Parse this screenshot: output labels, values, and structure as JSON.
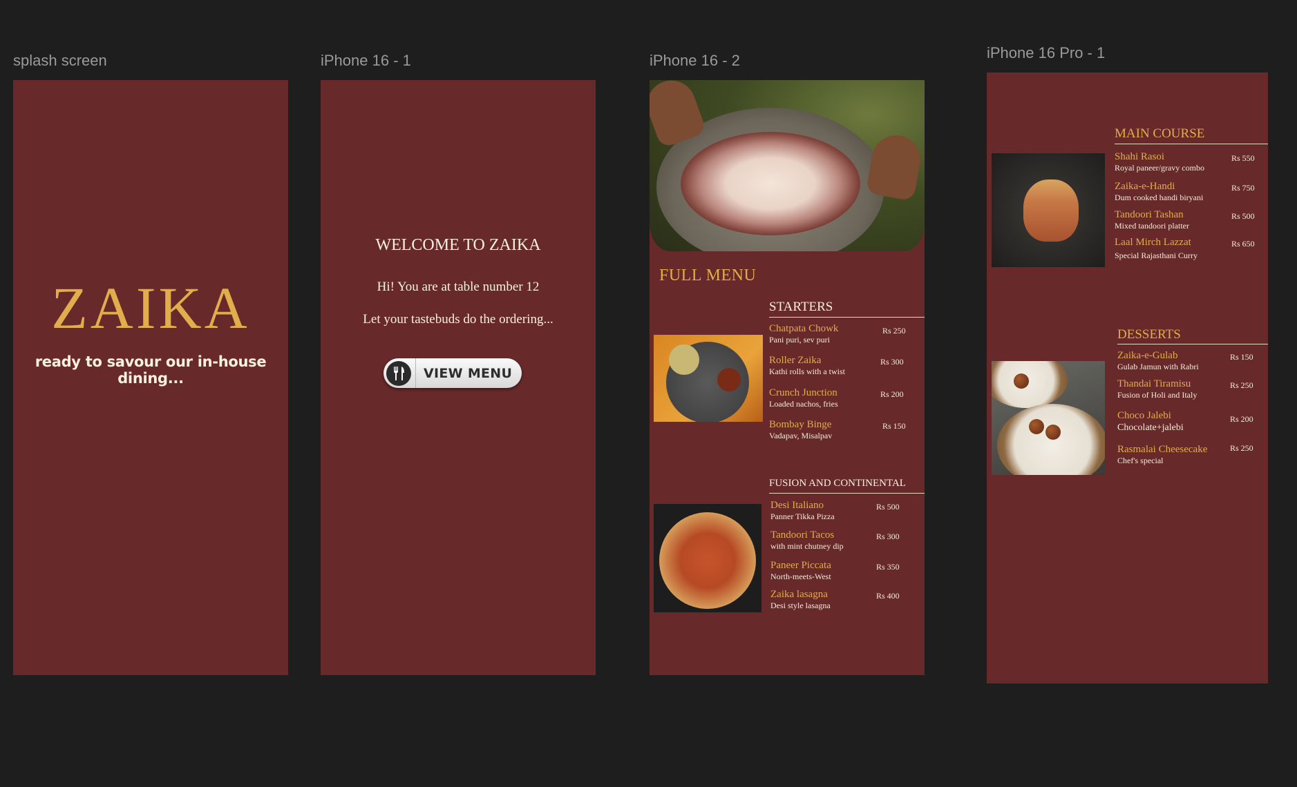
{
  "frames": {
    "splash": {
      "label": "splash screen",
      "logo": "ZAIKA",
      "tagline": "ready to savour our in-house dining..."
    },
    "welcome": {
      "label": "iPhone 16 - 1",
      "title": "WELCOME TO ZAIKA",
      "table_text": "Hi! You are at table number 12",
      "subtitle": "Let your tastebuds do the ordering...",
      "button_label": "VIEW MENU",
      "button_icon": "fork-knife-icon"
    },
    "full_menu": {
      "label": "iPhone 16 - 2",
      "heading": "FULL MENU",
      "starters": {
        "title": "STARTERS",
        "items": [
          {
            "name": "Chatpata Chowk",
            "desc": "Pani puri, sev puri",
            "price": "Rs 250"
          },
          {
            "name": "Roller Zaika",
            "desc": "Kathi rolls with a twist",
            "price": "Rs 300"
          },
          {
            "name": "Crunch Junction",
            "desc": "Loaded nachos, fries",
            "price": "Rs 200"
          },
          {
            "name": "Bombay Binge",
            "desc": "Vadapav, Misalpav",
            "price": "Rs 150"
          }
        ]
      },
      "fusion": {
        "title": "FUSION AND CONTINENTAL",
        "items": [
          {
            "name": "Desi Italiano",
            "desc": "Panner Tikka Pizza",
            "price": "Rs 500"
          },
          {
            "name": "Tandoori Tacos",
            "desc": "with mint chutney dip",
            "price": "Rs 300"
          },
          {
            "name": "Paneer Piccata",
            "desc": "North-meets-West",
            "price": "Rs 350"
          },
          {
            "name": "Zaika lasagna",
            "desc": "Desi style lasagna",
            "price": "Rs 400"
          }
        ]
      }
    },
    "menu2": {
      "label": "iPhone 16 Pro - 1",
      "main_course": {
        "title": "MAIN COURSE",
        "items": [
          {
            "name": "Shahi Rasoi",
            "desc": "Royal paneer/gravy combo",
            "price": "Rs 550"
          },
          {
            "name": "Zaika-e-Handi",
            "desc": "Dum cooked handi biryani",
            "price": "Rs 750"
          },
          {
            "name": "Tandoori Tashan",
            "desc": "Mixed tandoori platter",
            "price": "Rs 500"
          },
          {
            "name": "Laal Mirch Lazzat",
            "desc": "Special Rajasthani Curry",
            "price": "Rs 650"
          }
        ]
      },
      "desserts": {
        "title": "DESSERTS",
        "items": [
          {
            "name": "Zaika-e-Gulab",
            "desc": "Gulab Jamun with Rabri",
            "price": "Rs 150"
          },
          {
            "name": "Thandai Tiramisu",
            "desc": "Fusion of Holi and Italy",
            "price": "Rs 250"
          },
          {
            "name": "Choco Jalebi",
            "desc": "Chocolate+jalebi",
            "price": "Rs 200"
          },
          {
            "name": "Rasmalai Cheesecake",
            "desc": "Chef's special",
            "price": "Rs 250"
          }
        ]
      }
    }
  },
  "colors": {
    "frame_bg": "#67292a",
    "gold": "#e2ad4d",
    "cream": "#f6ecd9",
    "canvas": "#1e1e1e"
  }
}
